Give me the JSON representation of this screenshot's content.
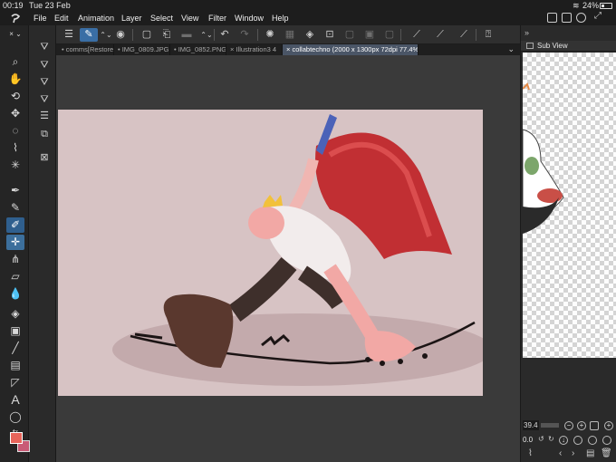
{
  "status": {
    "time": "00:19",
    "date": "Tue 23 Feb",
    "battery": "24%"
  },
  "menu": {
    "items": [
      "File",
      "Edit",
      "Animation",
      "Layer",
      "Select",
      "View",
      "Filter",
      "Window",
      "Help"
    ]
  },
  "tabs": [
    {
      "label": "comms[Restore"
    },
    {
      "label": "IMG_0809.JPG"
    },
    {
      "label": "IMG_0852.PNG"
    },
    {
      "label": "Illustration3 4"
    },
    {
      "label": "collabtechno (2000 x 1300px 72dpi 77.4%)"
    }
  ],
  "sub_view": {
    "title": "Sub View"
  },
  "navigator": {
    "zoom": "39.4",
    "rotation": "0.0"
  },
  "colors": {
    "main": "#e7645a",
    "sub": "#c95b76",
    "accent": "#2f5f8e",
    "canvas_bg": "#d7c3c4"
  }
}
